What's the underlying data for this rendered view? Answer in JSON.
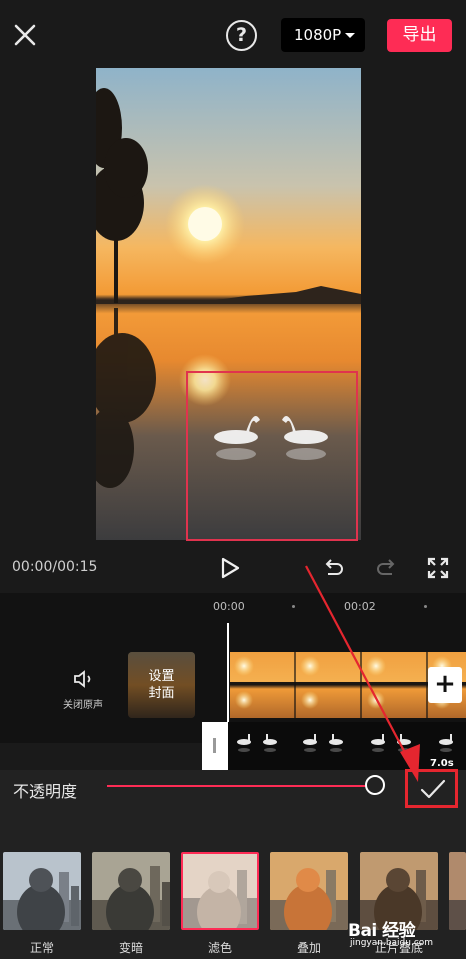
{
  "header": {
    "resolution": "1080P",
    "export_label": "导出"
  },
  "player": {
    "timecode": "00:00/00:15"
  },
  "timeline": {
    "ticks": [
      "00:00",
      "00:02"
    ],
    "mute_label": "关闭原声",
    "cover_label_line1": "设置",
    "cover_label_line2": "封面",
    "overlay_duration": "7.0s"
  },
  "panel": {
    "opacity_label": "不透明度",
    "opacity_value": 1.0,
    "blend_modes": [
      "正常",
      "变暗",
      "滤色",
      "叠加",
      "正片叠底"
    ],
    "selected_blend": "滤色"
  },
  "watermark": {
    "brand": "Bai 经验",
    "url": "jingyan.baidu.com"
  },
  "colors": {
    "accent": "#fe2c55",
    "annotation_red": "#e5262f",
    "background": "#1a1a1a"
  }
}
